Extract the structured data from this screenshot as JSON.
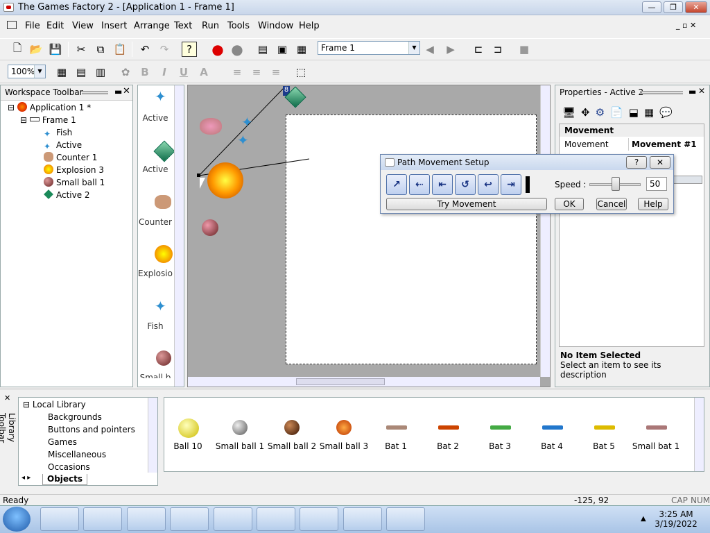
{
  "window": {
    "title": "The Games Factory 2 - [Application 1 - Frame 1]"
  },
  "menu": [
    "File",
    "Edit",
    "View",
    "Insert",
    "Arrange",
    "Text",
    "Run",
    "Tools",
    "Window",
    "Help"
  ],
  "toolbar": {
    "frame_select": "Frame 1",
    "zoom": "100%"
  },
  "workspace": {
    "title": "Workspace Toolbar",
    "app": "Application 1 *",
    "frame": "Frame 1",
    "objects": [
      "Fish",
      "Active",
      "Counter 1",
      "Explosion 3",
      "Small ball 1",
      "Active 2"
    ]
  },
  "object_strip": [
    "Active",
    "Active",
    "Counter",
    "Explosion",
    "Fish",
    "Small b"
  ],
  "canvas": {
    "badge": "8"
  },
  "properties": {
    "title": "Properties - Active 2",
    "section": "Movement",
    "row_label": "Movement",
    "row_value": "Movement #1",
    "info_title": "No Item Selected",
    "info_text": "Select an item to see its description"
  },
  "dialog": {
    "title": "Path Movement Setup",
    "speed_label": "Speed :",
    "speed_value": "50",
    "try_label": "Try Movement",
    "ok": "OK",
    "cancel": "Cancel",
    "help": "Help"
  },
  "library": {
    "title": "Library Toolbar",
    "tree_root": "Local Library",
    "tree_items": [
      "Backgrounds",
      "Buttons and pointers",
      "Games",
      "Miscellaneous",
      "Occasions"
    ],
    "tab": "Objects",
    "items": [
      "Ball 10",
      "Small ball 1",
      "Small ball 2",
      "Small ball 3",
      "Bat 1",
      "Bat 2",
      "Bat 3",
      "Bat 4",
      "Bat 5",
      "Small bat 1"
    ]
  },
  "status": {
    "left": "Ready",
    "coords": "-125, 92",
    "cap": "CAP",
    "num": "NUM"
  },
  "clock": {
    "time": "3:25 AM",
    "date": "3/19/2022"
  }
}
